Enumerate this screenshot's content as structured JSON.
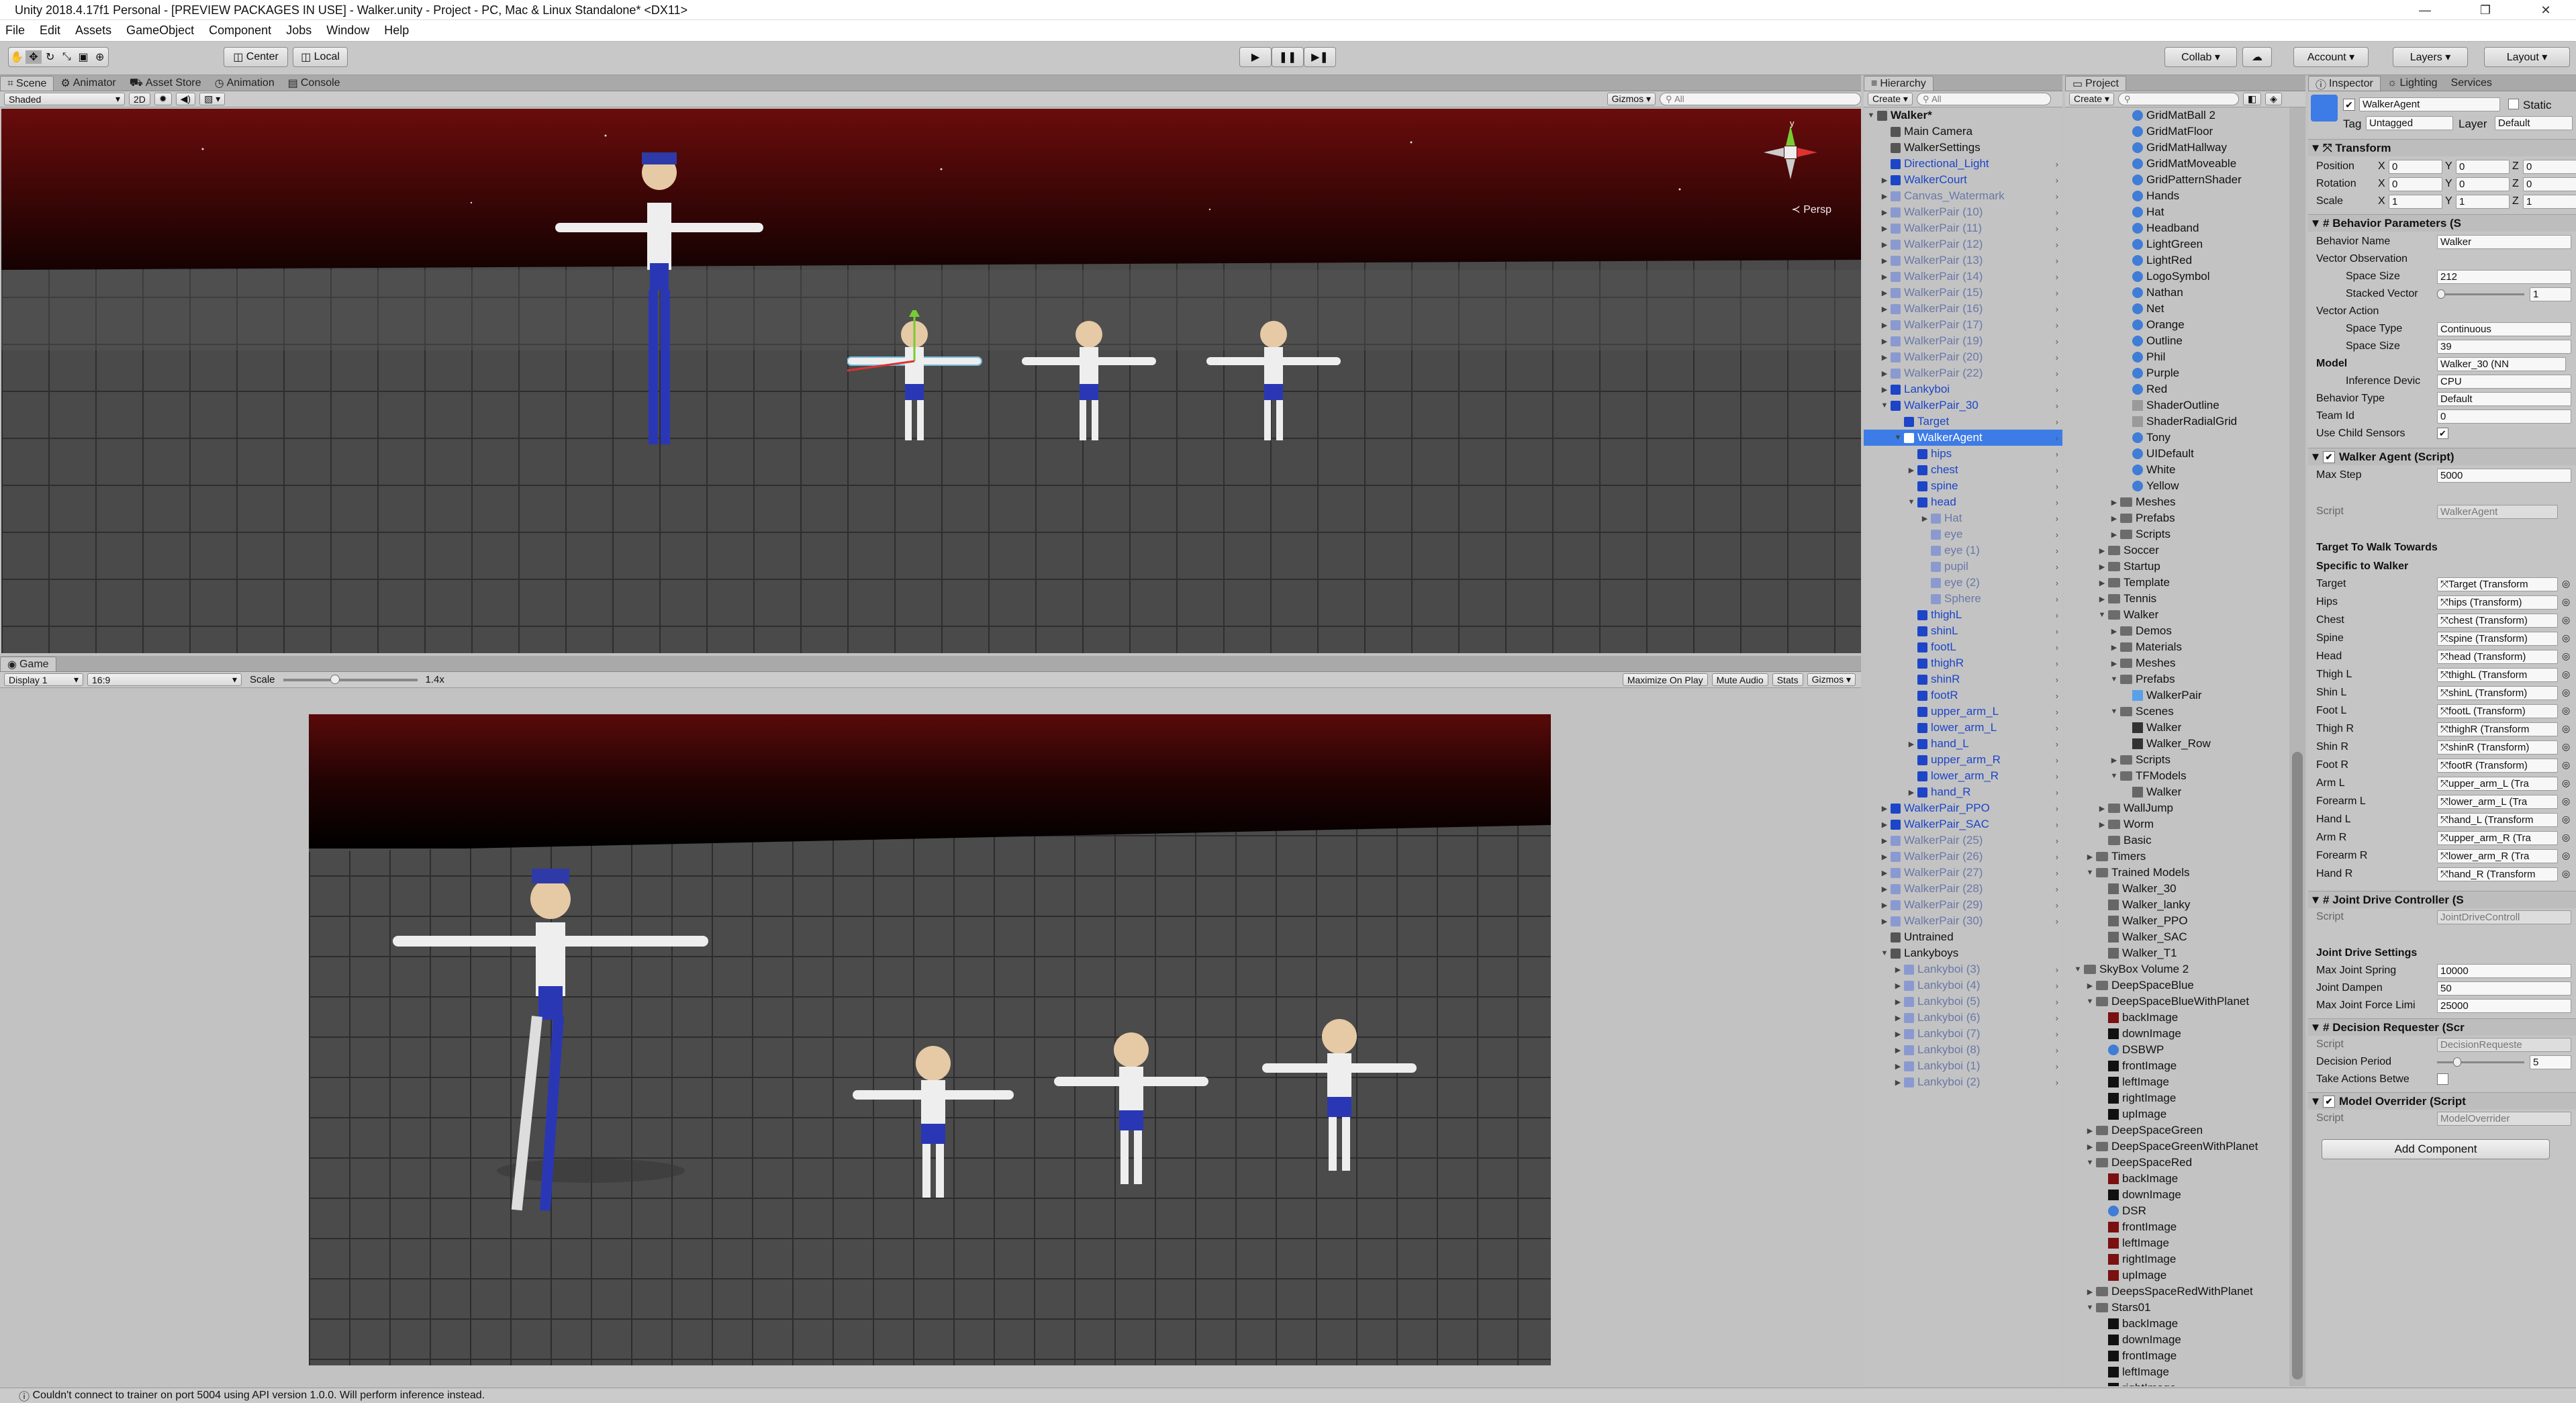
{
  "window": {
    "title": "Unity 2018.4.17f1 Personal - [PREVIEW PACKAGES IN USE] - Walker.unity - Project - PC, Mac & Linux Standalone* <DX11>",
    "min": "—",
    "max": "❐",
    "close": "✕"
  },
  "menu": [
    "File",
    "Edit",
    "Assets",
    "GameObject",
    "Component",
    "Jobs",
    "Window",
    "Help"
  ],
  "toolbar": {
    "center": "Center",
    "local": "Local",
    "collab": "Collab ▾",
    "account": "Account ▾",
    "layers": "Layers ▾",
    "layout": "Layout ▾"
  },
  "scene": {
    "tabs": [
      "Scene",
      "Animator",
      "Asset Store",
      "Animation",
      "Console"
    ],
    "shading": "Shaded",
    "mode2d": "2D",
    "gizmos": "Gizmos ▾",
    "search": "All",
    "persp": "Persp",
    "gizmo_y": "y"
  },
  "game": {
    "tab": "Game",
    "display": "Display 1",
    "aspect": "16:9",
    "scale_label": "Scale",
    "scale_value": "1.4x",
    "buttons": [
      "Maximize On Play",
      "Mute Audio",
      "Stats",
      "Gizmos ▾"
    ]
  },
  "colors": {
    "selection": "#3d7be6",
    "prefab_blue": "#1c45c8",
    "sky_red": "#7a1010"
  },
  "hierarchy": {
    "tab": "Hierarchy",
    "create": "Create ▾",
    "search": "All",
    "items": [
      {
        "t": "Walker*",
        "l": 0,
        "c": "normal",
        "e": "▼",
        "b": true
      },
      {
        "t": "Main Camera",
        "l": 1,
        "c": "normal",
        "e": ""
      },
      {
        "t": "WalkerSettings",
        "l": 1,
        "c": "normal",
        "e": ""
      },
      {
        "t": "Directional_Light",
        "l": 1,
        "c": "blue",
        "e": ""
      },
      {
        "t": "WalkerCourt",
        "l": 1,
        "c": "blue",
        "e": "▶"
      },
      {
        "t": "Canvas_Watermark",
        "l": 1,
        "c": "faint",
        "e": "▶"
      },
      {
        "t": "WalkerPair (10)",
        "l": 1,
        "c": "faint",
        "e": "▶"
      },
      {
        "t": "WalkerPair (11)",
        "l": 1,
        "c": "faint",
        "e": "▶"
      },
      {
        "t": "WalkerPair (12)",
        "l": 1,
        "c": "faint",
        "e": "▶"
      },
      {
        "t": "WalkerPair (13)",
        "l": 1,
        "c": "faint",
        "e": "▶"
      },
      {
        "t": "WalkerPair (14)",
        "l": 1,
        "c": "faint",
        "e": "▶"
      },
      {
        "t": "WalkerPair (15)",
        "l": 1,
        "c": "faint",
        "e": "▶"
      },
      {
        "t": "WalkerPair (16)",
        "l": 1,
        "c": "faint",
        "e": "▶"
      },
      {
        "t": "WalkerPair (17)",
        "l": 1,
        "c": "faint",
        "e": "▶"
      },
      {
        "t": "WalkerPair (19)",
        "l": 1,
        "c": "faint",
        "e": "▶"
      },
      {
        "t": "WalkerPair (20)",
        "l": 1,
        "c": "faint",
        "e": "▶"
      },
      {
        "t": "WalkerPair (22)",
        "l": 1,
        "c": "faint",
        "e": "▶"
      },
      {
        "t": "Lankyboi",
        "l": 1,
        "c": "blue",
        "e": "▶"
      },
      {
        "t": "WalkerPair_30",
        "l": 1,
        "c": "blue",
        "e": "▼"
      },
      {
        "t": "Target",
        "l": 2,
        "c": "blue",
        "e": ""
      },
      {
        "t": "WalkerAgent",
        "l": 2,
        "c": "sel",
        "e": "▼"
      },
      {
        "t": "hips",
        "l": 3,
        "c": "blue",
        "e": ""
      },
      {
        "t": "chest",
        "l": 3,
        "c": "blue",
        "e": "▶"
      },
      {
        "t": "spine",
        "l": 3,
        "c": "blue",
        "e": ""
      },
      {
        "t": "head",
        "l": 3,
        "c": "blue",
        "e": "▼"
      },
      {
        "t": "Hat",
        "l": 4,
        "c": "faint",
        "e": "▶"
      },
      {
        "t": "eye",
        "l": 4,
        "c": "faint",
        "e": ""
      },
      {
        "t": "eye (1)",
        "l": 4,
        "c": "faint",
        "e": ""
      },
      {
        "t": "pupil",
        "l": 4,
        "c": "faint",
        "e": ""
      },
      {
        "t": "eye (2)",
        "l": 4,
        "c": "faint",
        "e": ""
      },
      {
        "t": "Sphere",
        "l": 4,
        "c": "faint",
        "e": ""
      },
      {
        "t": "thighL",
        "l": 3,
        "c": "blue",
        "e": ""
      },
      {
        "t": "shinL",
        "l": 3,
        "c": "blue",
        "e": ""
      },
      {
        "t": "footL",
        "l": 3,
        "c": "blue",
        "e": ""
      },
      {
        "t": "thighR",
        "l": 3,
        "c": "blue",
        "e": ""
      },
      {
        "t": "shinR",
        "l": 3,
        "c": "blue",
        "e": ""
      },
      {
        "t": "footR",
        "l": 3,
        "c": "blue",
        "e": ""
      },
      {
        "t": "upper_arm_L",
        "l": 3,
        "c": "blue",
        "e": ""
      },
      {
        "t": "lower_arm_L",
        "l": 3,
        "c": "blue",
        "e": ""
      },
      {
        "t": "hand_L",
        "l": 3,
        "c": "blue",
        "e": "▶"
      },
      {
        "t": "upper_arm_R",
        "l": 3,
        "c": "blue",
        "e": ""
      },
      {
        "t": "lower_arm_R",
        "l": 3,
        "c": "blue",
        "e": ""
      },
      {
        "t": "hand_R",
        "l": 3,
        "c": "blue",
        "e": "▶"
      },
      {
        "t": "WalkerPair_PPO",
        "l": 1,
        "c": "blue",
        "e": "▶"
      },
      {
        "t": "WalkerPair_SAC",
        "l": 1,
        "c": "blue",
        "e": "▶"
      },
      {
        "t": "WalkerPair (25)",
        "l": 1,
        "c": "faint",
        "e": "▶"
      },
      {
        "t": "WalkerPair (26)",
        "l": 1,
        "c": "faint",
        "e": "▶"
      },
      {
        "t": "WalkerPair (27)",
        "l": 1,
        "c": "faint",
        "e": "▶"
      },
      {
        "t": "WalkerPair (28)",
        "l": 1,
        "c": "faint",
        "e": "▶"
      },
      {
        "t": "WalkerPair (29)",
        "l": 1,
        "c": "faint",
        "e": "▶"
      },
      {
        "t": "WalkerPair (30)",
        "l": 1,
        "c": "faint",
        "e": "▶"
      },
      {
        "t": "Untrained",
        "l": 1,
        "c": "normal",
        "e": ""
      },
      {
        "t": "Lankyboys",
        "l": 1,
        "c": "normal",
        "e": "▼"
      },
      {
        "t": "Lankyboi (3)",
        "l": 2,
        "c": "faint",
        "e": "▶"
      },
      {
        "t": "Lankyboi (4)",
        "l": 2,
        "c": "faint",
        "e": "▶"
      },
      {
        "t": "Lankyboi (5)",
        "l": 2,
        "c": "faint",
        "e": "▶"
      },
      {
        "t": "Lankyboi (6)",
        "l": 2,
        "c": "faint",
        "e": "▶"
      },
      {
        "t": "Lankyboi (7)",
        "l": 2,
        "c": "faint",
        "e": "▶"
      },
      {
        "t": "Lankyboi (8)",
        "l": 2,
        "c": "faint",
        "e": "▶"
      },
      {
        "t": "Lankyboi (1)",
        "l": 2,
        "c": "faint",
        "e": "▶"
      },
      {
        "t": "Lankyboi (2)",
        "l": 2,
        "c": "faint",
        "e": "▶"
      }
    ]
  },
  "project": {
    "tab": "Project",
    "create": "Create ▾",
    "items": [
      {
        "t": "GridMatBall 2",
        "l": 5,
        "k": "ball"
      },
      {
        "t": "GridMatFloor",
        "l": 5,
        "k": "ball"
      },
      {
        "t": "GridMatHallway",
        "l": 5,
        "k": "ball"
      },
      {
        "t": "GridMatMoveable",
        "l": 5,
        "k": "ball"
      },
      {
        "t": "GridPatternShader",
        "l": 5,
        "k": "ball"
      },
      {
        "t": "Hands",
        "l": 5,
        "k": "ball"
      },
      {
        "t": "Hat",
        "l": 5,
        "k": "ball"
      },
      {
        "t": "Headband",
        "l": 5,
        "k": "ball"
      },
      {
        "t": "LightGreen",
        "l": 5,
        "k": "ball"
      },
      {
        "t": "LightRed",
        "l": 5,
        "k": "ball"
      },
      {
        "t": "LogoSymbol",
        "l": 5,
        "k": "ball"
      },
      {
        "t": "Nathan",
        "l": 5,
        "k": "ball"
      },
      {
        "t": "Net",
        "l": 5,
        "k": "ball"
      },
      {
        "t": "Orange",
        "l": 5,
        "k": "ball"
      },
      {
        "t": "Outline",
        "l": 5,
        "k": "ball"
      },
      {
        "t": "Phil",
        "l": 5,
        "k": "ball"
      },
      {
        "t": "Purple",
        "l": 5,
        "k": "ball"
      },
      {
        "t": "Red",
        "l": 5,
        "k": "ball"
      },
      {
        "t": "ShaderOutline",
        "l": 5,
        "k": "shader"
      },
      {
        "t": "ShaderRadialGrid",
        "l": 5,
        "k": "shader"
      },
      {
        "t": "Tony",
        "l": 5,
        "k": "ball"
      },
      {
        "t": "UIDefault",
        "l": 5,
        "k": "ball"
      },
      {
        "t": "White",
        "l": 5,
        "k": "ball"
      },
      {
        "t": "Yellow",
        "l": 5,
        "k": "ball"
      },
      {
        "t": "Meshes",
        "l": 4,
        "k": "folder",
        "e": "▶"
      },
      {
        "t": "Prefabs",
        "l": 4,
        "k": "folder",
        "e": "▶"
      },
      {
        "t": "Scripts",
        "l": 4,
        "k": "folder",
        "e": "▶"
      },
      {
        "t": "Soccer",
        "l": 3,
        "k": "folder",
        "e": "▶"
      },
      {
        "t": "Startup",
        "l": 3,
        "k": "folder",
        "e": "▶"
      },
      {
        "t": "Template",
        "l": 3,
        "k": "folder",
        "e": "▶"
      },
      {
        "t": "Tennis",
        "l": 3,
        "k": "folder",
        "e": "▶"
      },
      {
        "t": "Walker",
        "l": 3,
        "k": "folder",
        "e": "▼"
      },
      {
        "t": "Demos",
        "l": 4,
        "k": "folder",
        "e": "▶"
      },
      {
        "t": "Materials",
        "l": 4,
        "k": "folder",
        "e": "▶"
      },
      {
        "t": "Meshes",
        "l": 4,
        "k": "folder",
        "e": "▶"
      },
      {
        "t": "Prefabs",
        "l": 4,
        "k": "folder",
        "e": "▼"
      },
      {
        "t": "WalkerPair",
        "l": 5,
        "k": "prefab"
      },
      {
        "t": "Scenes",
        "l": 4,
        "k": "folder",
        "e": "▼"
      },
      {
        "t": "Walker",
        "l": 5,
        "k": "unity"
      },
      {
        "t": "Walker_Row",
        "l": 5,
        "k": "unity"
      },
      {
        "t": "Scripts",
        "l": 4,
        "k": "folder",
        "e": "▶"
      },
      {
        "t": "TFModels",
        "l": 4,
        "k": "folder",
        "e": "▼"
      },
      {
        "t": "Walker",
        "l": 5,
        "k": "nn"
      },
      {
        "t": "WallJump",
        "l": 3,
        "k": "folder",
        "e": "▶"
      },
      {
        "t": "Worm",
        "l": 3,
        "k": "folder",
        "e": "▶"
      },
      {
        "t": "Basic",
        "l": 3,
        "k": "folder",
        "e": ""
      },
      {
        "t": "Timers",
        "l": 2,
        "k": "folder",
        "e": "▶"
      },
      {
        "t": "Trained Models",
        "l": 2,
        "k": "folder",
        "e": "▼"
      },
      {
        "t": "Walker_30",
        "l": 3,
        "k": "nn"
      },
      {
        "t": "Walker_lanky",
        "l": 3,
        "k": "nn"
      },
      {
        "t": "Walker_PPO",
        "l": 3,
        "k": "nn"
      },
      {
        "t": "Walker_SAC",
        "l": 3,
        "k": "nn"
      },
      {
        "t": "Walker_T1",
        "l": 3,
        "k": "nn"
      },
      {
        "t": "SkyBox Volume 2",
        "l": 1,
        "k": "folder",
        "e": "▼"
      },
      {
        "t": "DeepSpaceBlue",
        "l": 2,
        "k": "folder",
        "e": "▶"
      },
      {
        "t": "DeepSpaceBlueWithPlanet",
        "l": 2,
        "k": "folder",
        "e": "▼"
      },
      {
        "t": "backImage",
        "l": 3,
        "k": "texred"
      },
      {
        "t": "downImage",
        "l": 3,
        "k": "texdark"
      },
      {
        "t": "DSBWP",
        "l": 3,
        "k": "ball"
      },
      {
        "t": "frontImage",
        "l": 3,
        "k": "texdark"
      },
      {
        "t": "leftImage",
        "l": 3,
        "k": "texdark"
      },
      {
        "t": "rightImage",
        "l": 3,
        "k": "texdark"
      },
      {
        "t": "upImage",
        "l": 3,
        "k": "texdark"
      },
      {
        "t": "DeepSpaceGreen",
        "l": 2,
        "k": "folder",
        "e": "▶"
      },
      {
        "t": "DeepSpaceGreenWithPlanet",
        "l": 2,
        "k": "folder",
        "e": "▶"
      },
      {
        "t": "DeepSpaceRed",
        "l": 2,
        "k": "folder",
        "e": "▼"
      },
      {
        "t": "backImage",
        "l": 3,
        "k": "texred"
      },
      {
        "t": "downImage",
        "l": 3,
        "k": "texdark"
      },
      {
        "t": "DSR",
        "l": 3,
        "k": "ball"
      },
      {
        "t": "frontImage",
        "l": 3,
        "k": "texred"
      },
      {
        "t": "leftImage",
        "l": 3,
        "k": "texred"
      },
      {
        "t": "rightImage",
        "l": 3,
        "k": "texred"
      },
      {
        "t": "upImage",
        "l": 3,
        "k": "texred"
      },
      {
        "t": "DeepsSpaceRedWithPlanet",
        "l": 2,
        "k": "folder",
        "e": "▶"
      },
      {
        "t": "Stars01",
        "l": 2,
        "k": "folder",
        "e": "▼"
      },
      {
        "t": "backImage",
        "l": 3,
        "k": "texdark"
      },
      {
        "t": "downImage",
        "l": 3,
        "k": "texdark"
      },
      {
        "t": "frontImage",
        "l": 3,
        "k": "texdark"
      },
      {
        "t": "leftImage",
        "l": 3,
        "k": "texdark"
      },
      {
        "t": "rightImage",
        "l": 3,
        "k": "texdark"
      }
    ]
  },
  "inspector": {
    "tabs": [
      "Inspector",
      "Lighting",
      "Services"
    ],
    "name": "WalkerAgent",
    "static": "Static",
    "tag_label": "Tag",
    "tag": "Untagged",
    "layer_label": "Layer",
    "layer": "Default",
    "transform": {
      "title": "Transform",
      "rows": [
        {
          "l": "Position",
          "x": "0",
          "y": "0",
          "z": "0"
        },
        {
          "l": "Rotation",
          "x": "0",
          "y": "0",
          "z": "0"
        },
        {
          "l": "Scale",
          "x": "1",
          "y": "1",
          "z": "1"
        }
      ]
    },
    "behavior": {
      "title": "Behavior Parameters (S",
      "name_label": "Behavior Name",
      "name": "Walker",
      "vec_obs": "Vector Observation",
      "space_size_label": "Space Size",
      "space_size": "212",
      "stacked_label": "Stacked Vector",
      "stacked": "1",
      "stacked_fraction": 0.0,
      "vec_act": "Vector Action",
      "space_type_label": "Space Type",
      "space_type": "Continuous",
      "act_size_label": "Space Size",
      "act_size": "39",
      "model_label": "Model",
      "model": "Walker_30 (NN",
      "device_label": "Inference Devic",
      "device": "CPU",
      "btype_label": "Behavior Type",
      "btype": "Default",
      "team_label": "Team Id",
      "team": "0",
      "child_label": "Use Child Sensors"
    },
    "agent": {
      "title": "Walker Agent (Script)",
      "max_step_label": "Max Step",
      "max_step": "5000",
      "script_label": "Script",
      "script": "WalkerAgent",
      "section1": "Target To Walk Towards",
      "section2": "Specific to Walker",
      "refs": [
        {
          "l": "Target",
          "v": "Target (Transform"
        },
        {
          "l": "Hips",
          "v": "hips (Transform)"
        },
        {
          "l": "Chest",
          "v": "chest (Transform)"
        },
        {
          "l": "Spine",
          "v": "spine (Transform)"
        },
        {
          "l": "Head",
          "v": "head (Transform)"
        },
        {
          "l": "Thigh L",
          "v": "thighL (Transform"
        },
        {
          "l": "Shin L",
          "v": "shinL (Transform)"
        },
        {
          "l": "Foot L",
          "v": "footL (Transform)"
        },
        {
          "l": "Thigh R",
          "v": "thighR (Transform"
        },
        {
          "l": "Shin R",
          "v": "shinR (Transform)"
        },
        {
          "l": "Foot R",
          "v": "footR (Transform)"
        },
        {
          "l": "Arm L",
          "v": "upper_arm_L (Tra"
        },
        {
          "l": "Forearm L",
          "v": "lower_arm_L (Tra"
        },
        {
          "l": "Hand L",
          "v": "hand_L (Transform"
        },
        {
          "l": "Arm R",
          "v": "upper_arm_R (Tra"
        },
        {
          "l": "Forearm R",
          "v": "lower_arm_R (Tra"
        },
        {
          "l": "Hand R",
          "v": "hand_R (Transform"
        }
      ]
    },
    "jdc": {
      "title": "Joint Drive Controller (S",
      "script_label": "Script",
      "script": "JointDriveControll",
      "section": "Joint Drive Settings",
      "spring_label": "Max Joint Spring",
      "spring": "10000",
      "damp_label": "Joint Dampen",
      "damp": "50",
      "force_label": "Max Joint Force Limi",
      "force": "25000"
    },
    "dr": {
      "title": "Decision Requester (Scr",
      "script_label": "Script",
      "script": "DecisionRequeste",
      "period_label": "Decision Period",
      "period": "5",
      "period_fraction": 0.2,
      "take_label": "Take Actions Betwe"
    },
    "mo": {
      "title": "Model Overrider (Script",
      "script_label": "Script",
      "script": "ModelOverrider"
    },
    "add": "Add Component"
  },
  "status": "Couldn't connect to trainer on port 5004 using API version 1.0.0. Will perform inference instead."
}
